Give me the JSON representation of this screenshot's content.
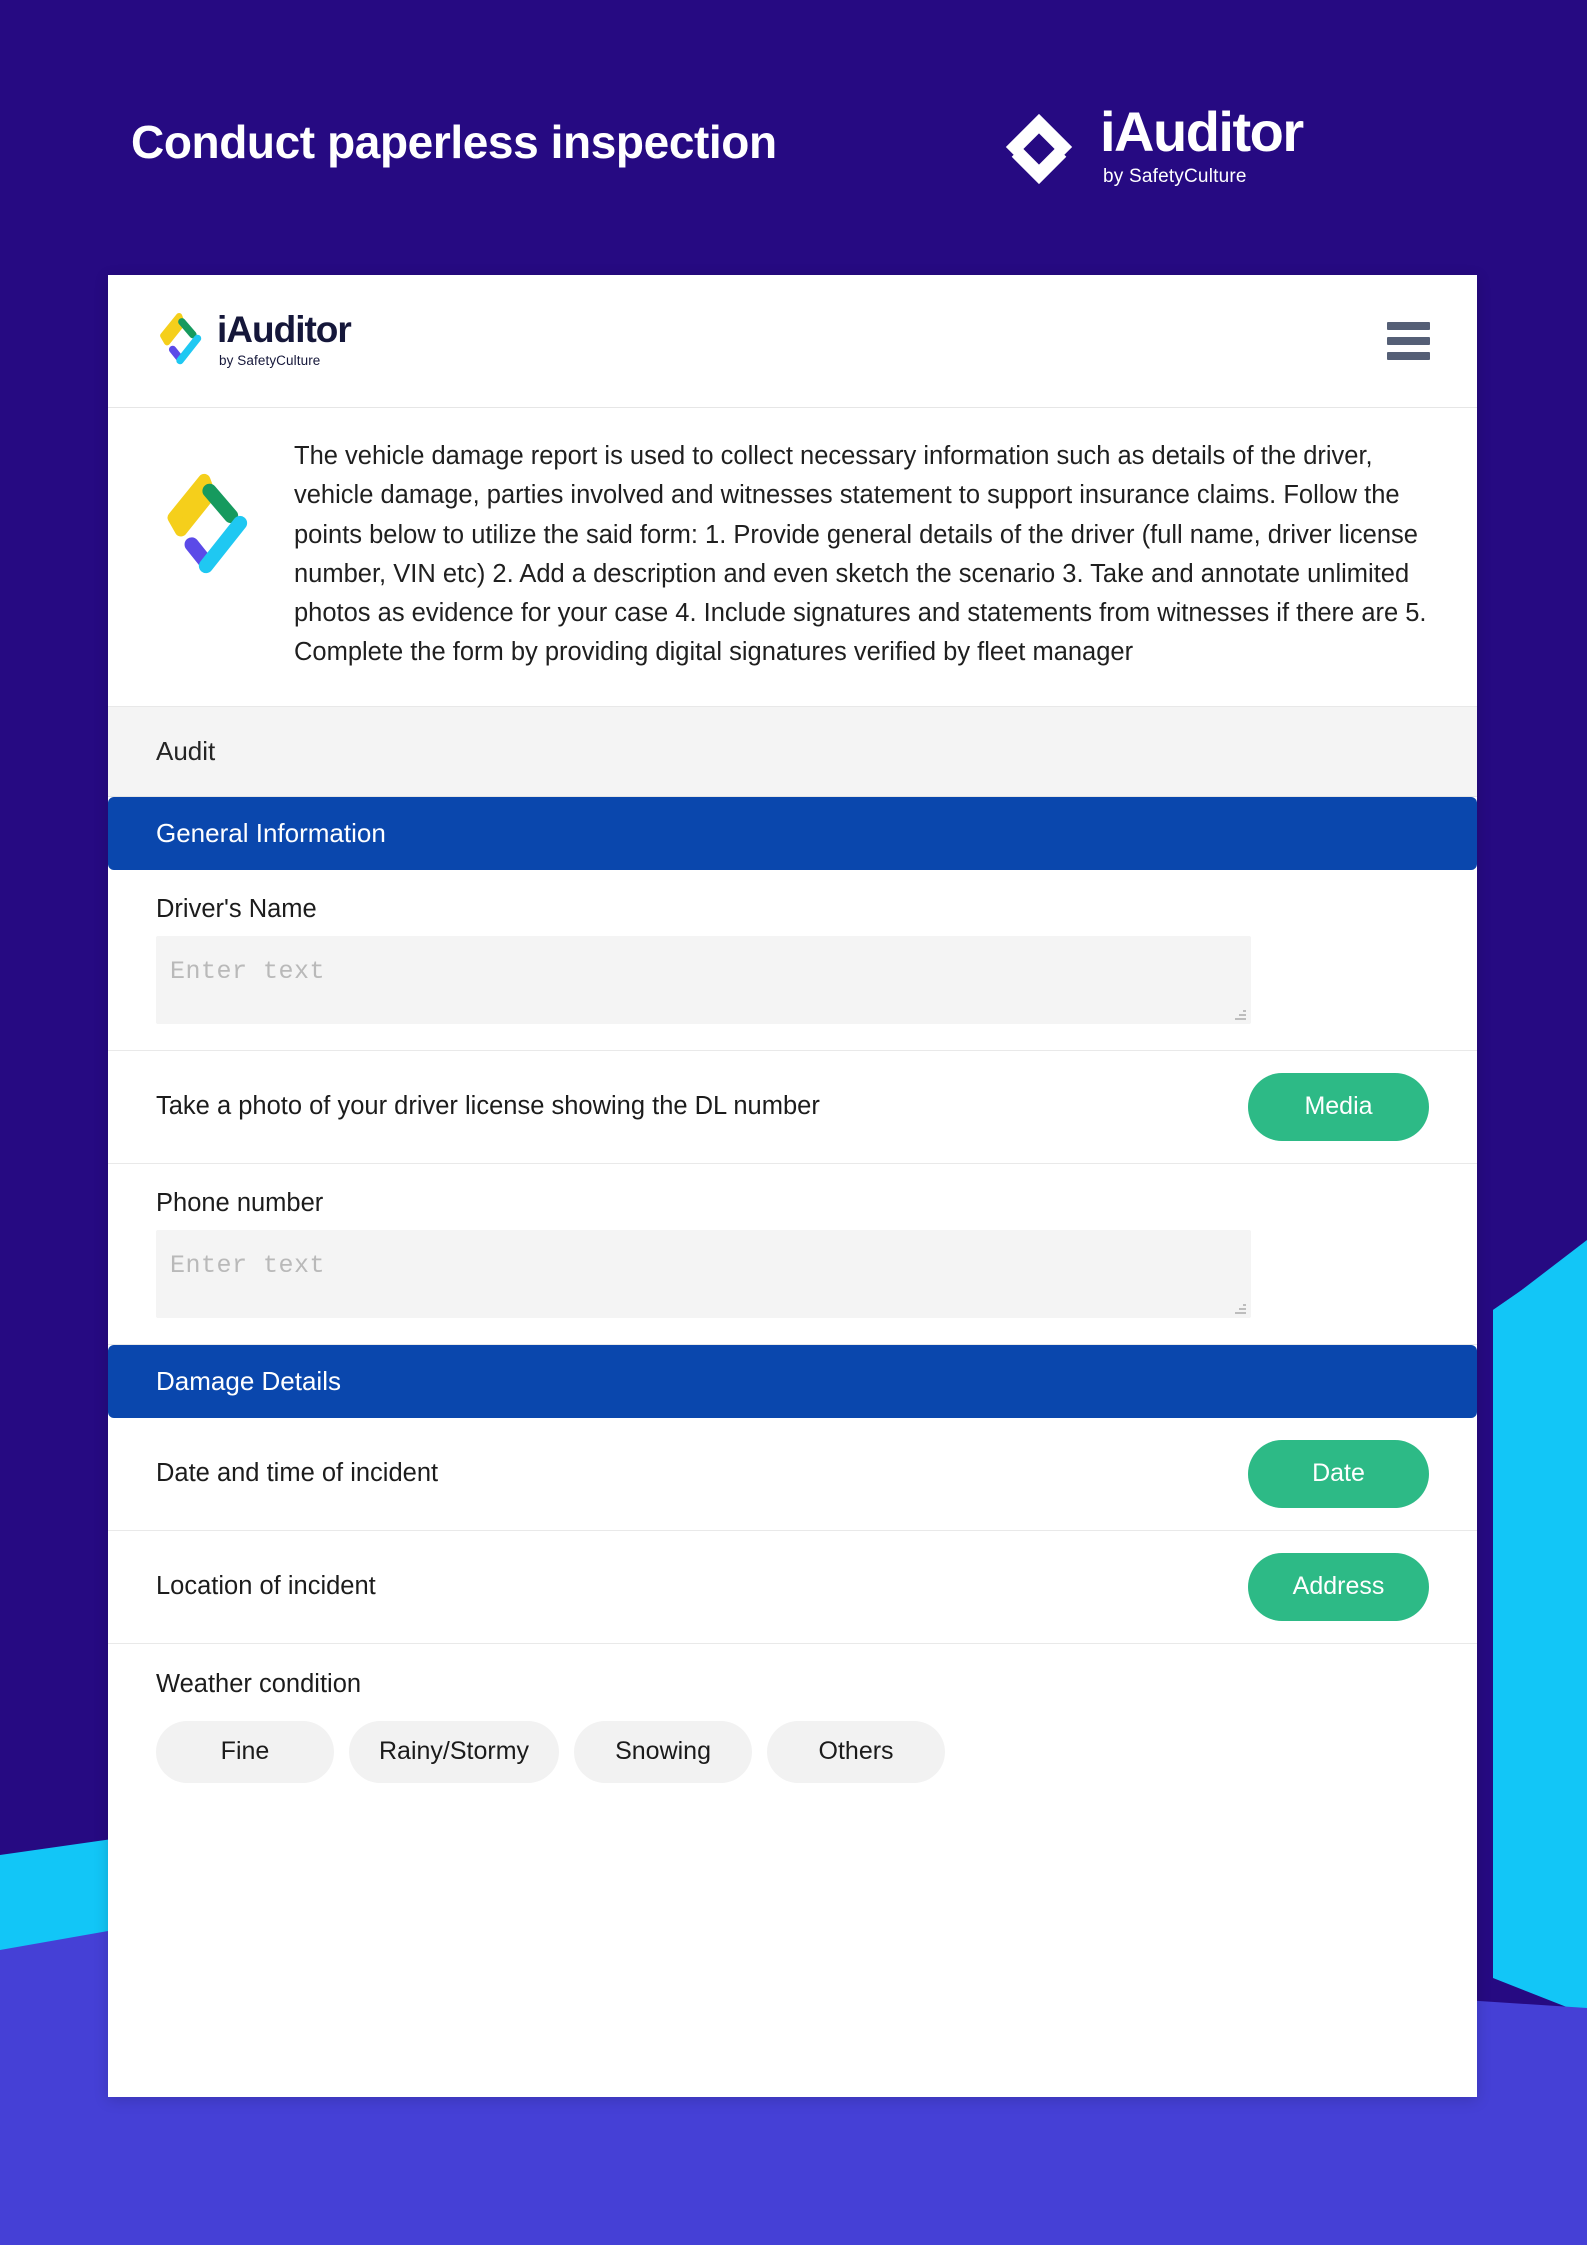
{
  "banner": {
    "title": "Conduct paperless inspection",
    "brand_name": "iAuditor",
    "brand_tagline": "by SafetyCulture",
    "logo_icon": "iauditor-chevron-mark"
  },
  "appbar": {
    "brand_name": "iAuditor",
    "brand_tagline": "by SafetyCulture",
    "logo_icon": "iauditor-diamond-mark",
    "menu_icon": "hamburger-menu-icon"
  },
  "description": {
    "icon": "iauditor-diamond-mark",
    "text": "The vehicle damage report is used to collect necessary information such as details of the driver, vehicle damage, parties involved and witnesses statement to support insurance claims. Follow the points below to utilize the said form: 1. Provide general details of the driver (full name, driver license number, VIN etc) 2. Add a description and even sketch the scenario 3. Take and annotate unlimited photos as evidence for your case 4. Include signatures and statements from witnesses if there are 5. Complete the form by providing digital signatures verified by fleet manager"
  },
  "audit": {
    "label": "Audit"
  },
  "sections": {
    "general_information": {
      "title": "General Information",
      "drivers_name": {
        "label": "Driver's Name",
        "value": "",
        "placeholder": "Enter text"
      },
      "driver_license_photo": {
        "label": "Take a photo of your driver license showing the DL number",
        "button": "Media"
      },
      "phone_number": {
        "label": "Phone number",
        "value": "",
        "placeholder": "Enter text"
      }
    },
    "damage_details": {
      "title": "Damage Details",
      "incident_datetime": {
        "label": "Date and time of incident",
        "button": "Date"
      },
      "incident_location": {
        "label": "Location of incident",
        "button": "Address"
      },
      "weather_condition": {
        "label": "Weather condition",
        "options": [
          "Fine",
          "Rainy/Stormy",
          "Snowing",
          "Others"
        ]
      }
    }
  },
  "colors": {
    "page_background": "#260a82",
    "page_background_lower": "#4540d6",
    "accent_cyan": "#12c6f7",
    "section_header_blue": "#0a47ad",
    "action_green": "#2dba86",
    "card_background": "#ffffff",
    "logo_yellow": "#f5cf1b",
    "logo_green": "#169a5e",
    "logo_purple": "#5b4ae8",
    "logo_cyan": "#1fc8f2"
  }
}
